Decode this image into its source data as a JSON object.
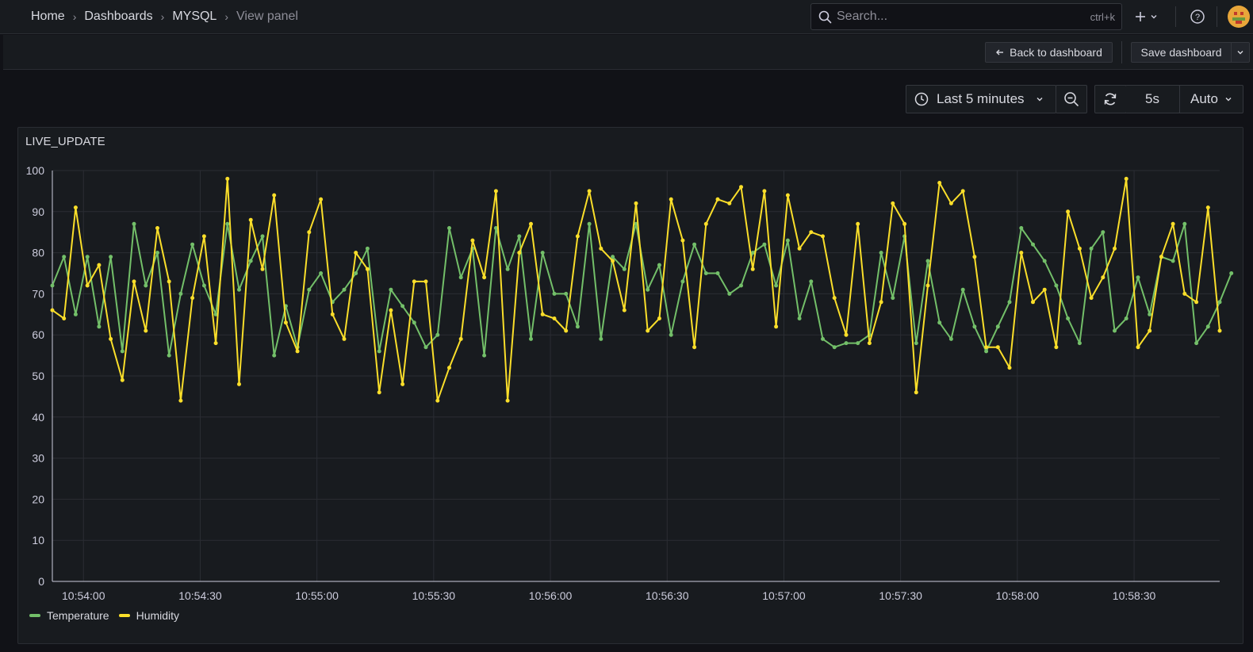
{
  "breadcrumb": {
    "items": [
      "Home",
      "Dashboards",
      "MYSQL",
      "View panel"
    ]
  },
  "search": {
    "placeholder": "Search...",
    "shortcut": "ctrl+k"
  },
  "toolbar": {
    "back_label": "Back to dashboard",
    "save_label": "Save dashboard"
  },
  "time_controls": {
    "range_label": "Last 5 minutes",
    "refresh_interval": "5s",
    "auto_label": "Auto"
  },
  "panel": {
    "title": "LIVE_UPDATE"
  },
  "colors": {
    "temperature": "#73bf69",
    "humidity": "#fade2a",
    "grid": "#2a2d33",
    "axis": "#ccccdc"
  },
  "chart_data": {
    "type": "line",
    "title": "LIVE_UPDATE",
    "ylim": [
      0,
      100
    ],
    "y_ticks": [
      0,
      10,
      20,
      30,
      40,
      50,
      60,
      70,
      80,
      90,
      100
    ],
    "x_ticks": [
      "10:54:00",
      "10:54:30",
      "10:55:00",
      "10:55:30",
      "10:56:00",
      "10:56:30",
      "10:57:00",
      "10:57:30",
      "10:58:00",
      "10:58:30"
    ],
    "x_start": "10:53:52",
    "x_end": "10:58:52",
    "sample_interval_s": 3,
    "grid": true,
    "legend_position": "bottom-left",
    "series": [
      {
        "name": "Temperature",
        "color": "#73bf69",
        "values": [
          72,
          79,
          65,
          79,
          62,
          79,
          56,
          87,
          72,
          80,
          55,
          70,
          82,
          72,
          65,
          87,
          71,
          78,
          84,
          55,
          67,
          57,
          71,
          75,
          68,
          71,
          75,
          81,
          56,
          71,
          67,
          63,
          57,
          60,
          86,
          74,
          81,
          55,
          86,
          76,
          84,
          59,
          80,
          70,
          70,
          62,
          87,
          59,
          79,
          76,
          87,
          71,
          77,
          60,
          73,
          82,
          75,
          75,
          70,
          72,
          80,
          82,
          72,
          83,
          64,
          73,
          59,
          57,
          58,
          58,
          60,
          80,
          69,
          84,
          58,
          78,
          63,
          59,
          71,
          62,
          56,
          62,
          68,
          86,
          82,
          78,
          72,
          64,
          58,
          81,
          85,
          61,
          64,
          74,
          65,
          79,
          78,
          87,
          58,
          62,
          68,
          75
        ]
      },
      {
        "name": "Humidity",
        "color": "#fade2a",
        "values": [
          66,
          64,
          91,
          72,
          77,
          59,
          49,
          73,
          61,
          86,
          73,
          44,
          69,
          84,
          58,
          98,
          48,
          88,
          76,
          94,
          63,
          56,
          85,
          93,
          65,
          59,
          80,
          76,
          46,
          66,
          48,
          73,
          73,
          44,
          52,
          59,
          83,
          74,
          95,
          44,
          80,
          87,
          65,
          64,
          61,
          84,
          95,
          81,
          78,
          66,
          92,
          61,
          64,
          93,
          83,
          57,
          87,
          93,
          92,
          96,
          76,
          95,
          62,
          94,
          81,
          85,
          84,
          69,
          60,
          87,
          58,
          68,
          92,
          87,
          46,
          72,
          97,
          92,
          95,
          79,
          57,
          57,
          52,
          80,
          68,
          71,
          57,
          90,
          81,
          69,
          74,
          81,
          98,
          57,
          61,
          79,
          87,
          70,
          68,
          91,
          61
        ]
      }
    ]
  }
}
